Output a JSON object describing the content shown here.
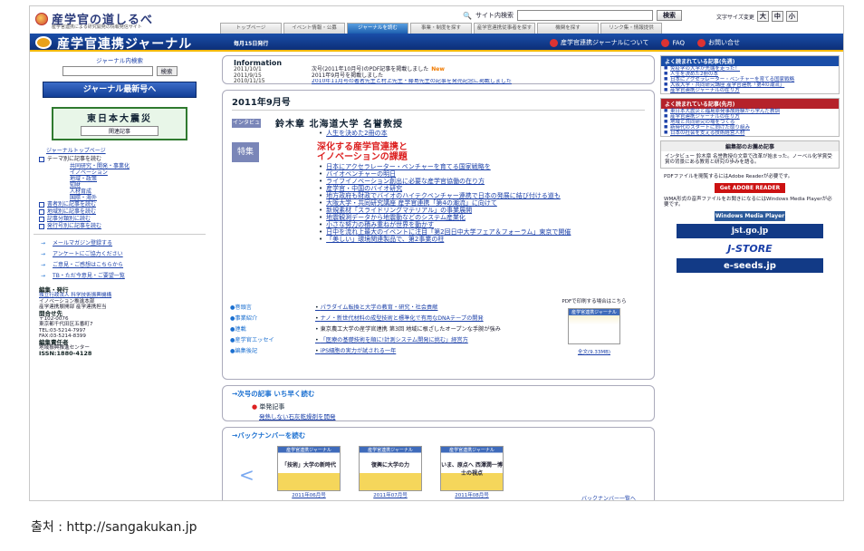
{
  "site": {
    "logo_title": "産学官の道しるべ",
    "logo_sub": "産学官連携による研究開発の情報発信サイト",
    "search_label": "サイト内検索",
    "search_button": "検索",
    "font_size_label": "文字サイズ変更",
    "font_sizes": [
      "大",
      "中",
      "小"
    ]
  },
  "tabs": [
    "トップページ",
    "イベント情報・公募",
    "ジャーナルを読む",
    "事業・制度を探す",
    "産学官連携従事者を探す",
    "機関を探す",
    "リンク集・情報提供"
  ],
  "banner": {
    "title": "産学官連携ジャーナル",
    "issue_note": "毎月15日発行",
    "nav": [
      "産学官連携ジャーナルについて",
      "FAQ",
      "お問い合せ"
    ]
  },
  "left": {
    "journal_search_label": "ジャーナル内検索",
    "journal_search_button": "検索",
    "latest_button": "ジャーナル最新号へ",
    "quake_title": "東日本大震災",
    "quake_sub": "関連記事",
    "journal_top": "ジャーナルトップページ",
    "category_header": "テーマ別に記事を読む",
    "categories": [
      "共同研究・開発・事業化",
      "イノベーション",
      "地域・政策",
      "知財",
      "人材育成",
      "国際・海外",
      "書者別に記事を読む",
      "地域別に記事を読む",
      "記事分類別に読む",
      "発行号別に記事を読む"
    ],
    "tools": [
      "メールマガジン登録する",
      "アンケートにご協力ください",
      "ご意見・ご感想はこちらから",
      "TB・ただ今意見・ご要望一覧"
    ],
    "pub": {
      "h1": "編集・発行",
      "l1": "独立行政法人 科学技術振興機構",
      "l2": "イノベーション推進本部",
      "l3": "産学連携展開部 産学連携担当",
      "h2": "問合せ先",
      "l4": "〒102-0076",
      "l5": "東京都千代田区五番町7",
      "l6": "TEL:03-5214-7997",
      "l7": "FAX:03-5214-8399",
      "h3": "編集責任者",
      "l8": "地域振興推進センター",
      "issn": "ISSN:1880-4128"
    }
  },
  "info": {
    "header": "Information",
    "rows": [
      {
        "date": "2011/10/1",
        "text": "次号(2011年10月号)のPDF記事を掲載しました",
        "new": "New"
      },
      {
        "date": "2011/9/15",
        "text": "2011年9月号を掲載しました",
        "new": ""
      },
      {
        "date": "2010/11/15",
        "text": "2010年11月号の著者先生と村上先生・藤島先生の記事を発売記念に掲載しました",
        "new": ""
      }
    ]
  },
  "issue": {
    "heading": "2011年9月号",
    "interview_tag": "インタビュー",
    "interview_name": "鈴木章 北海道大学 名誉教授",
    "interview_link": "人生を決めた2冊の本",
    "feature_tag": "特集",
    "feature_title_1": "深化する産学官連携と",
    "feature_title_2": "イノベーションの課題",
    "feature_links": [
      "日本にアクセラレーター・ベンチャーを育てる国家戦略を",
      "バイオベンチャーの明日",
      "ライフイノベーション創出に必要な産学官協働の在り方",
      "産学官・中国のバイオ研究",
      "地方政府も財政でバイオのハイテクベンチャー連携で日本の発展に結び付ける道も",
      "大阪大学・共同研究講座 産学官連携「第4の潮流」に向けて",
      "新規素材「スライドリングマテリアル」の事業展開",
      "地震観測データから地震動などのシステム産業化",
      "小さな努力の積み重ねが世界を動かす",
      "日中を流れ上最大のイベントに注目「第2回日中大学フェア＆フォーラム」東京で開催",
      "「美しい」環境関連製品で、第2事業の柱"
    ],
    "cols": [
      {
        "k": "●巻頭言",
        "v": "パラダイム転換と大学の教育・研究・社会貢献"
      },
      {
        "k": "●事業紹介",
        "v": "ナノ・新世代材料の成型技術と標準化で有用なDNAテープの開発"
      },
      {
        "k": "●連載",
        "v": "東京農工大学の産学官連携 第3回 地域に根ざしたオープンな手腕が強み"
      },
      {
        "k": "●産学官エッセイ",
        "v": "「医療の基礎技術を順に!計測システム開発に挑む」経営方"
      },
      {
        "k": "●編集後記",
        "v": "iPS細胞の実力が試される一年"
      }
    ],
    "side_pdf": "PDFで印刷する場合はこちら",
    "side_cover_title": "産学官連携ジャーナル",
    "side_pdf_link": "全文(9.33MB)"
  },
  "next": {
    "header": "次号の記事 いち早く読む",
    "item": "単発記事",
    "item_link": "発熱しない石灰乾燥剤を開発"
  },
  "back": {
    "header": "バックナンバーを読む",
    "covers": [
      {
        "title": "産学官連携ジャーナル",
        "headline": "「技術」大学の新時代",
        "issue": "2011年06月号"
      },
      {
        "title": "産学官連携ジャーナル",
        "headline": "復興に大学の力",
        "issue": "2011年07月号"
      },
      {
        "title": "産学官連携ジャーナル",
        "headline": "いま、原点へ 西澤潤一博士の視点",
        "issue": "2011年08月号"
      }
    ],
    "more": "バックナンバー一覧へ"
  },
  "right": {
    "popular_now_header": "よく読まれている記事(先週)",
    "popular_now": [
      "免疫学の大学が先端を走った！",
      "人生を決めた2冊の本",
      "日本にアクセラレーター・ベンチャーを育てる国家戦略",
      "大阪大学・共同研究講座 産学官連携「第4の潮流」",
      "産学官連携ジャーナルの在り方"
    ],
    "popular_month_header": "よく読まれている記事(先月)",
    "popular_month": [
      "東日本大震災と福島原発事故経験から学んだ教訓",
      "産学官連携ジャーナルの在り方",
      "地域と共同研究の場をつくる",
      "新時代のスタートに向けた取り組み",
      "日本の社会を支える技術経営人材"
    ],
    "recommend_header": "編集部のお薦め記事",
    "recommend_text": "インタビュー 鈴木章 名誉教授の文章で改革が始まった。ノーベル化学賞受賞の背景にある教育と研究の歩みを語る。",
    "pdf_note": "PDFファイルを閲覧するにはAdobe Readerが必要です。",
    "adobe": "Get ADOBE READER",
    "wmp_note": "WMA形式の音声ファイルをお聞きになるにはWindows Media Playerが必要です。",
    "wmp": "Windows Media Player",
    "jst": "jst.go.jp",
    "jstore": "J-STORE",
    "eseeds": "e-seeds.jp"
  },
  "caption": "출처 : http://sangakukan.jp"
}
